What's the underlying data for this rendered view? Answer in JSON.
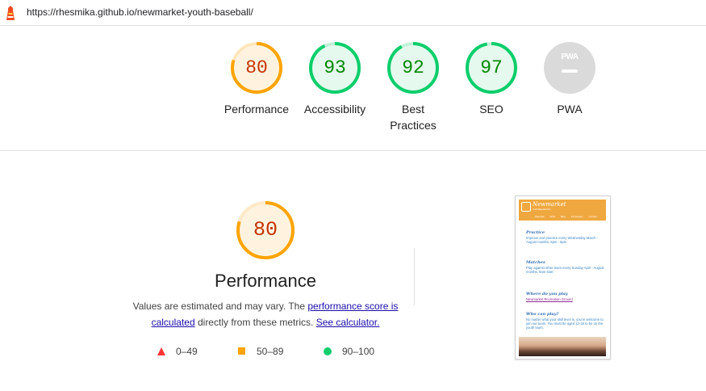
{
  "browser": {
    "url": "https://rhesmika.github.io/newmarket-youth-baseball/",
    "logo_icon": "lighthouse-icon"
  },
  "gauges": [
    {
      "key": "performance",
      "score": "80",
      "label": "Performance",
      "fraction": 0.8,
      "color": "#ffa400",
      "text_color": "#c33300",
      "fill": "#fff3e0"
    },
    {
      "key": "accessibility",
      "score": "93",
      "label": "Accessibility",
      "fraction": 0.93,
      "color": "#0cce6b",
      "text_color": "#008800",
      "fill": "#e5f9ee"
    },
    {
      "key": "best-practices",
      "score": "92",
      "label": "Best Practices",
      "fraction": 0.92,
      "color": "#0cce6b",
      "text_color": "#008800",
      "fill": "#e5f9ee"
    },
    {
      "key": "seo",
      "score": "97",
      "label": "SEO",
      "fraction": 0.97,
      "color": "#0cce6b",
      "text_color": "#008800",
      "fill": "#e5f9ee"
    },
    {
      "key": "pwa",
      "badge": "PWA",
      "label": "PWA",
      "color": "#dadada"
    }
  ],
  "performance_section": {
    "score": "80",
    "fraction": 0.8,
    "title": "Performance",
    "desc_prefix": "Values are estimated and may vary. The ",
    "link_score": "performance score is calculated",
    "desc_middle": " directly from these metrics. ",
    "link_calc": "See calculator."
  },
  "legend": [
    {
      "shape": "triangle",
      "range": "0–49",
      "color": "#ff3333"
    },
    {
      "shape": "square",
      "range": "50–89",
      "color": "#ffa400"
    },
    {
      "shape": "circle",
      "range": "90–100",
      "color": "#0cce6b"
    }
  ],
  "screenshot": {
    "site_title": "Newmarket",
    "site_subtitle": "Youth Baseball Club",
    "nav": [
      "Baseball Drills",
      "Blog",
      "Information",
      "Contact"
    ],
    "sections": [
      {
        "heading": "Practice",
        "text": "Improve and practice every Wednesday March - August months, 6pm - 8pm"
      },
      {
        "heading": "Matches",
        "text": "Play against other team every Sunday April - August months, 9am start"
      },
      {
        "heading": "Where do you play",
        "link": "Newmarket Recreation Ground"
      },
      {
        "heading": "Who can play?",
        "text": "No matter what your skill level is, you're welcome to join our team. You must be aged 12-18 to be on the youth team."
      }
    ]
  }
}
